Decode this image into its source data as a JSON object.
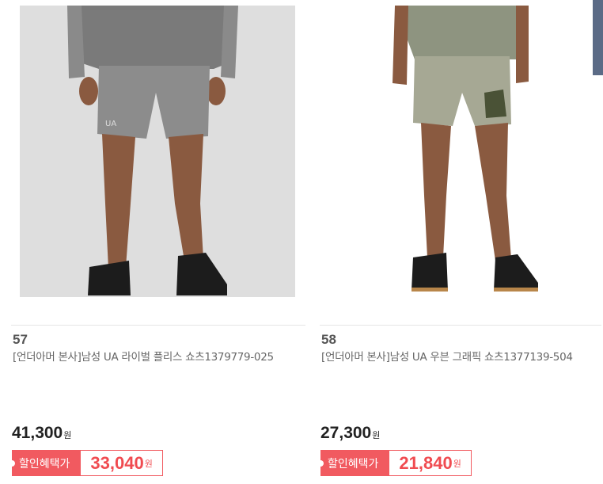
{
  "products": [
    {
      "rank": "57",
      "name": "[언더아머 본사]남성 UA 라이벌 플리스 쇼츠1379779-025",
      "original_price": "41,300",
      "currency": "원",
      "discount_label": "할인혜택가",
      "sale_price": "33,040",
      "image_icon": "gray-fleece-shorts-photo"
    },
    {
      "rank": "58",
      "name": "[언더아머 본사]남성 UA 우븐 그래픽 쇼츠1377139-504",
      "original_price": "27,300",
      "currency": "원",
      "discount_label": "할인혜택가",
      "sale_price": "21,840",
      "image_icon": "green-graphic-shorts-photo"
    }
  ],
  "colors": {
    "accent": "#f15a60",
    "sale_text": "#f04b50"
  }
}
